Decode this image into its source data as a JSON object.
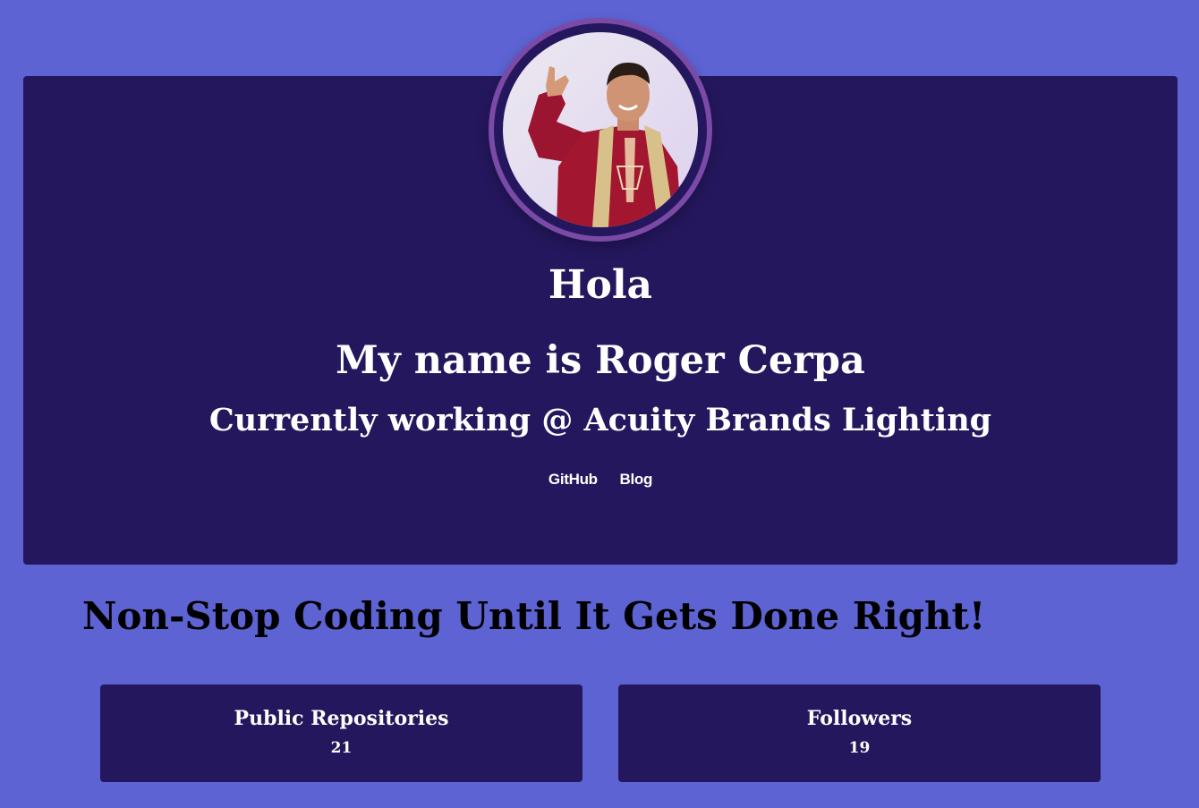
{
  "hero": {
    "greeting": "Hola",
    "name_line": "My name is Roger Cerpa",
    "work_line": "Currently working @ Acuity Brands Lighting",
    "links": [
      {
        "label": "GitHub"
      },
      {
        "label": "Blog"
      }
    ],
    "avatar": {
      "icon": "profile-photo"
    }
  },
  "tagline": "Non-Stop Coding Until It Gets Done Right!",
  "stats": {
    "repos": {
      "label": "Public Repositories",
      "value": "21"
    },
    "followers": {
      "label": "Followers",
      "value": "19"
    }
  },
  "colors": {
    "page_bg": "#5d63d3",
    "card_bg": "#24175d",
    "avatar_ring": "#7a4aa6",
    "text_light": "#ffffff",
    "text_dark": "#000000"
  }
}
